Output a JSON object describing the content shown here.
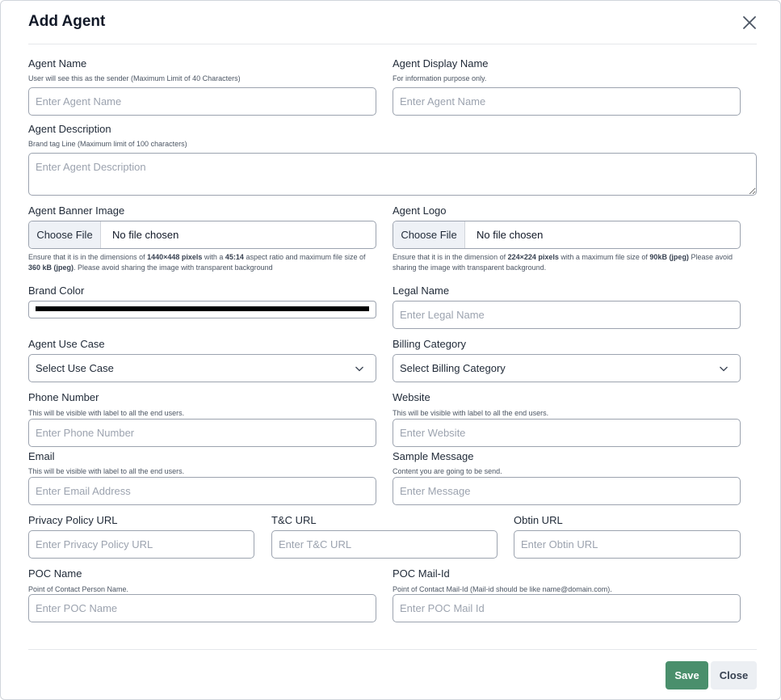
{
  "dialog": {
    "title": "Add Agent",
    "close_icon": "close-icon"
  },
  "fields": {
    "agent_name": {
      "label": "Agent Name",
      "hint": "User will see this as the sender (Maximum Limit of 40 Characters)",
      "placeholder": "Enter Agent Name",
      "value": ""
    },
    "agent_display_name": {
      "label": "Agent Display Name",
      "hint": "For information purpose only.",
      "placeholder": "Enter Agent Name",
      "value": ""
    },
    "agent_description": {
      "label": "Agent Description",
      "hint": "Brand tag Line (Maximum limit of 100 characters)",
      "placeholder": "Enter Agent Description",
      "value": ""
    },
    "agent_banner_image": {
      "label": "Agent Banner Image",
      "button": "Choose File",
      "file_status": "No file chosen",
      "note": {
        "p1": "Ensure that it is in the dimensions of ",
        "b1": "1440×448 pixels",
        "p2": " with a ",
        "b2": "45:14",
        "p3": " aspect ratio and maximum file size of ",
        "b3": "360 kB (jpeg)",
        "p4": ". Please avoid sharing the image with transparent background"
      }
    },
    "agent_logo": {
      "label": "Agent Logo",
      "button": "Choose File",
      "file_status": "No file chosen",
      "note": {
        "p1": "Ensure that it is in the dimension of ",
        "b1": "224×224 pixels",
        "p2": " with a maximum file size of ",
        "b2": "90kB (jpeg)",
        "p3": " Please avoid sharing the image with transparent background."
      }
    },
    "brand_color": {
      "label": "Brand Color",
      "value": "#000000"
    },
    "legal_name": {
      "label": "Legal Name",
      "placeholder": "Enter Legal Name",
      "value": ""
    },
    "agent_use_case": {
      "label": "Agent Use Case",
      "selected": "Select Use Case"
    },
    "billing_category": {
      "label": "Billing Category",
      "selected": "Select Billing Category"
    },
    "phone_number": {
      "label": "Phone Number",
      "hint": "This will be visible with label to all the end users.",
      "placeholder": "Enter Phone Number",
      "value": ""
    },
    "website": {
      "label": "Website",
      "hint": "This will be visible with label to all the end users.",
      "placeholder": "Enter Website",
      "value": ""
    },
    "email": {
      "label": "Email",
      "hint": "This will be visible with label to all the end users.",
      "placeholder": "Enter Email Address",
      "value": ""
    },
    "sample_message": {
      "label": "Sample Message",
      "hint": "Content you are going to be send.",
      "placeholder": "Enter Message",
      "value": ""
    },
    "privacy_policy_url": {
      "label": "Privacy Policy URL",
      "placeholder": "Enter Privacy Policy URL",
      "value": ""
    },
    "tc_url": {
      "label": "T&C URL",
      "placeholder": "Enter T&C URL",
      "value": ""
    },
    "obtin_url": {
      "label": "Obtin URL",
      "placeholder": "Enter Obtin URL",
      "value": ""
    },
    "poc_name": {
      "label": "POC Name",
      "hint": "Point of Contact Person Name.",
      "placeholder": "Enter POC Name",
      "value": ""
    },
    "poc_mail_id": {
      "label": "POC Mail-Id",
      "hint": "Point of Contact Mail-Id (Mail-id should be like name@domain.com).",
      "placeholder": "Enter POC Mail Id",
      "value": ""
    }
  },
  "footer": {
    "save_label": "Save",
    "close_label": "Close"
  },
  "colors": {
    "save_button": "#4a8f6c",
    "close_button": "#eceff3",
    "border": "#9ca3af"
  }
}
